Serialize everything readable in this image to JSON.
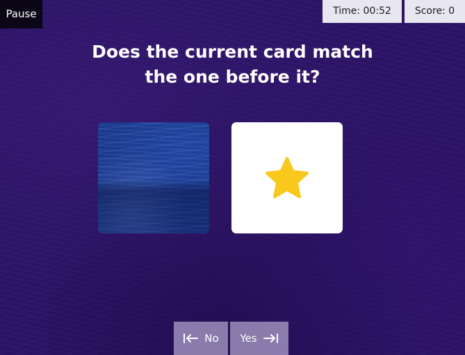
{
  "pause": {
    "label": "Pause"
  },
  "stats": {
    "time": "Time: 00:52",
    "score": "Score: 0"
  },
  "question": {
    "line1": "Does the current card match",
    "line2": "the one before it?"
  },
  "cards": {
    "previous": {
      "face": "card-back-texture"
    },
    "current": {
      "symbol": "star-icon",
      "symbol_color": "#f8c81c"
    }
  },
  "answers": {
    "no_label": "No",
    "no_icon": "arrow-left-to-bar-icon",
    "yes_label": "Yes",
    "yes_icon": "arrow-right-to-bar-icon"
  },
  "colors": {
    "background": "#2c1366",
    "card_back": "#1b3a8e",
    "card_face": "#ffffff",
    "star": "#f8c81c",
    "button": "#c8bee1"
  }
}
